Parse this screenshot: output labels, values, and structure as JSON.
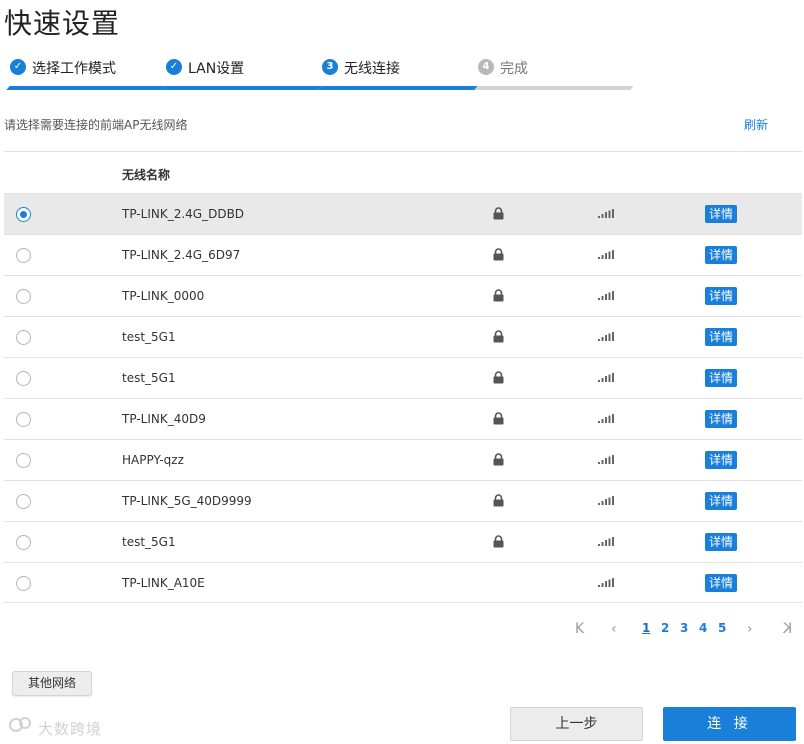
{
  "page": {
    "title": "快速设置"
  },
  "steps": [
    {
      "label": "选择工作模式",
      "badge": "✓",
      "state": "done"
    },
    {
      "label": "LAN设置",
      "badge": "✓",
      "state": "done"
    },
    {
      "label": "无线连接",
      "badge": "3",
      "state": "active"
    },
    {
      "label": "完成",
      "badge": "4",
      "state": "pending"
    }
  ],
  "hint": "请选择需要连接的前端AP无线网络",
  "refresh_label": "刷新",
  "table": {
    "column_name": "无线名称",
    "details_label": "详情",
    "rows": [
      {
        "ssid": "TP-LINK_2.4G_DDBD",
        "locked": true,
        "selected": true
      },
      {
        "ssid": "TP-LINK_2.4G_6D97",
        "locked": true,
        "selected": false
      },
      {
        "ssid": "TP-LINK_0000",
        "locked": true,
        "selected": false
      },
      {
        "ssid": "test_5G1",
        "locked": true,
        "selected": false
      },
      {
        "ssid": "test_5G1",
        "locked": true,
        "selected": false
      },
      {
        "ssid": "TP-LINK_40D9",
        "locked": true,
        "selected": false
      },
      {
        "ssid": "HAPPY-qzz",
        "locked": true,
        "selected": false
      },
      {
        "ssid": "TP-LINK_5G_40D9999",
        "locked": true,
        "selected": false
      },
      {
        "ssid": "test_5G1",
        "locked": true,
        "selected": false
      },
      {
        "ssid": "TP-LINK_A10E",
        "locked": false,
        "selected": false
      }
    ]
  },
  "pagination": {
    "first": "K",
    "prev": "‹",
    "next": "›",
    "last": "K",
    "pages": [
      "1",
      "2",
      "3",
      "4",
      "5"
    ],
    "current": "1"
  },
  "buttons": {
    "other_networks": "其他网络",
    "prev_step": "上一步",
    "connect": "连 接"
  },
  "watermark": "大数跨境",
  "colors": {
    "accent": "#1a7fd9",
    "pending": "#b9b9b9",
    "selected_row": "#e9e9e9"
  },
  "icons": {
    "lock": "lock-icon",
    "signal": "signal-icon",
    "checkmark": "check-icon"
  }
}
